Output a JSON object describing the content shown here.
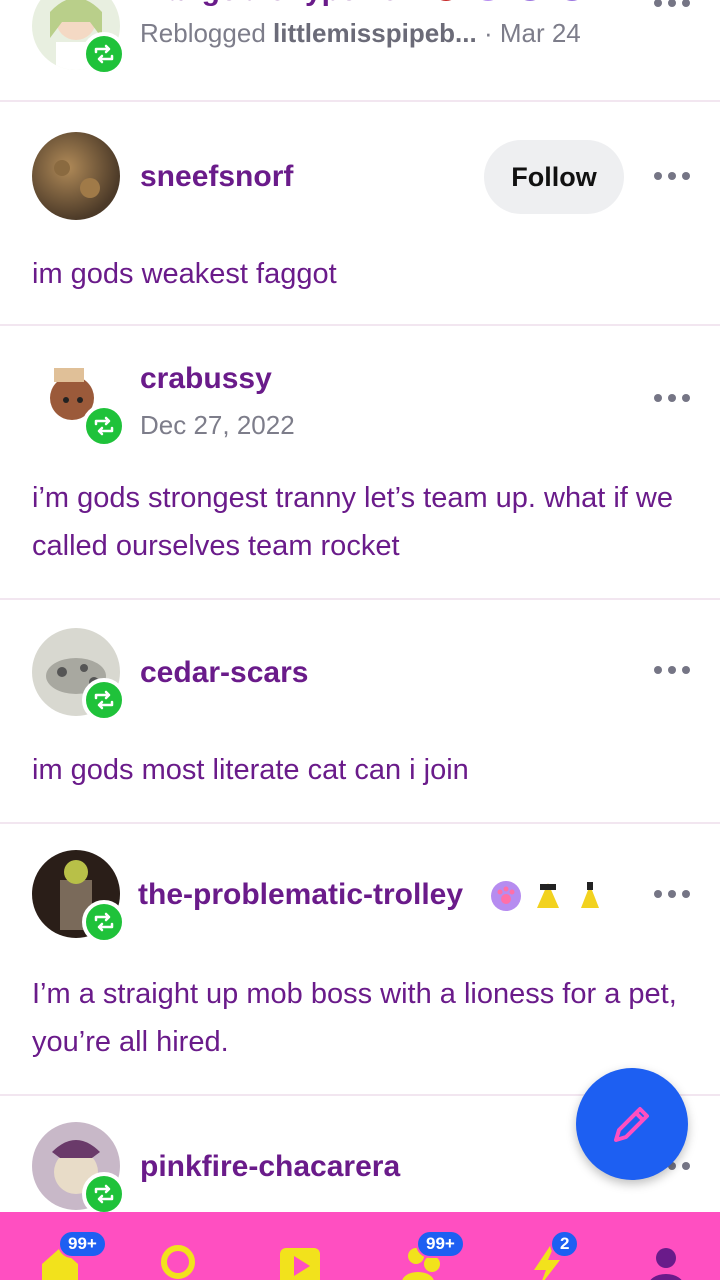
{
  "posts": [
    {
      "username": "mangobronypower",
      "meta_prefix": "Reblogged",
      "meta_source": "littlemisspipeb...",
      "meta_date": "· Mar 24",
      "badges": [
        "bot-badge-icon",
        "paw-badge-icon",
        "pumpkin-badge-icon",
        "skull-badge-icon"
      ]
    },
    {
      "username": "sneefsnorf",
      "follow_label": "Follow",
      "text": "im gods weakest faggot"
    },
    {
      "username": "crabussy",
      "date": "Dec 27, 2022",
      "text": "i’m gods strongest tranny let’s team up. what if we called ourselves team rocket"
    },
    {
      "username": "cedar-scars",
      "text": "im gods most literate cat can i join"
    },
    {
      "username": "the-problematic-trolley",
      "badges": [
        "paw-badge-icon",
        "pikachu-badge-icon",
        "pikachu-badge-icon"
      ],
      "text": "I’m a straight up mob boss with a lioness for a pet, you’re all hired."
    },
    {
      "username": "pinkfire-chacarera"
    }
  ],
  "tabbar": {
    "items": [
      {
        "name": "home-tab",
        "icon": "home-icon",
        "count": "99+"
      },
      {
        "name": "search-tab",
        "icon": "search-icon",
        "count": ""
      },
      {
        "name": "video-tab",
        "icon": "play-icon",
        "count": ""
      },
      {
        "name": "community-tab",
        "icon": "people-icon",
        "count": "99+"
      },
      {
        "name": "activity-tab",
        "icon": "lightning-icon",
        "count": "2"
      },
      {
        "name": "account-tab",
        "icon": "account-icon",
        "count": ""
      }
    ]
  },
  "colors": {
    "accent_purple": "#6a1b8a",
    "tabbar_pink": "#ff4fc1",
    "fab_blue": "#1d5ff2",
    "reblog_green": "#1fc23a"
  }
}
